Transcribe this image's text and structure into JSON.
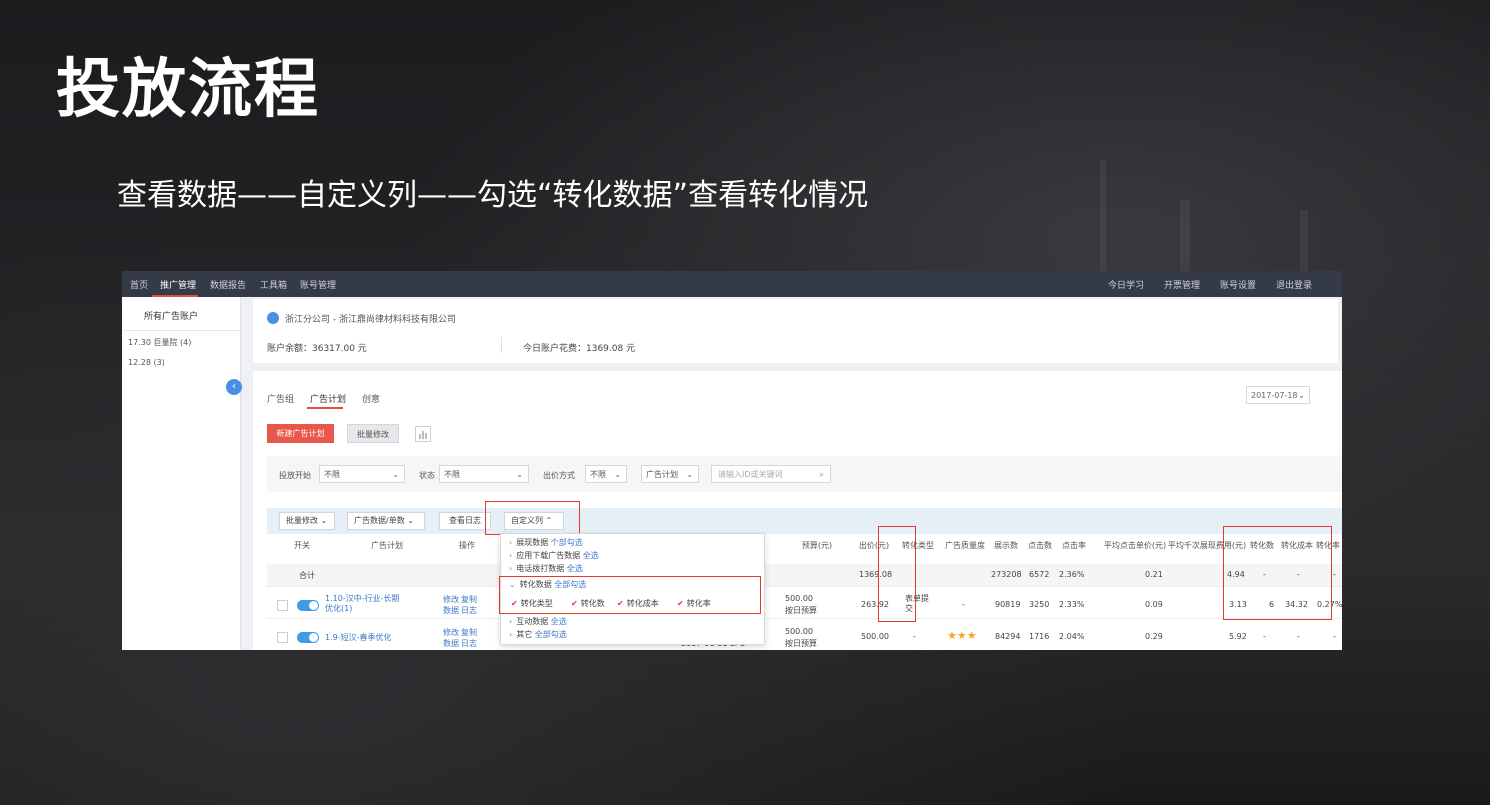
{
  "slide": {
    "title": "投放流程",
    "subtitle": "查看数据——自定义列——勾选“转化数据”查看转化情况"
  },
  "nav": {
    "items": [
      "首页",
      "推广管理",
      "数据报告",
      "工具箱",
      "账号管理"
    ],
    "right_items": [
      "今日学习",
      "开票管理",
      "账号设置",
      "退出登录"
    ]
  },
  "sidebar": {
    "title": "所有广告账户",
    "items": [
      "17.30 巨量院 (4)",
      "12.28 (3)"
    ]
  },
  "account": {
    "name": "浙江分公司 - 浙江鼎尚律材料科技有限公司",
    "balance": "账户余额：36317.00 元",
    "today_spend": "今日账户花费：1369.08 元"
  },
  "tabs": [
    "广告组",
    "广告计划",
    "创意"
  ],
  "date_select": "2017-07-18",
  "buttons": {
    "new_plan": "新建广告计划",
    "batch": "批量修改"
  },
  "filters": {
    "status_label": "投放开始",
    "status_value": "不限",
    "state_label": "状态",
    "state_value": "不限",
    "bid_label": "出价方式",
    "bid_value": "不限",
    "plan_select": "广告计划",
    "search_placeholder": "请输入ID或关键词"
  },
  "toolbar": {
    "batch_op": "批量修改",
    "data_switch": "广告数据/单数",
    "view_log": "查看日志",
    "custom_cols": "自定义列"
  },
  "table": {
    "headers": [
      "开关",
      "广告计划",
      "操作",
      "预算(元)",
      "出价(元)",
      "转化类型",
      "广告质量度",
      "展示数",
      "点击数",
      "点击率",
      "平均点击单价(元)",
      "平均千次展现费用(元)",
      "转化数",
      "转化成本",
      "转化率"
    ],
    "summary": {
      "label": "合计",
      "bid": "1369.08",
      "impressions": "273208",
      "clicks": "6572",
      "ctr": "2.36%",
      "cpc": "0.21",
      "cpm": "4.94",
      "conv": "-",
      "conv_cost": "-",
      "conv_rate": "-"
    },
    "rows": [
      {
        "name": "1.10-汉中-行业-长期优化(1)",
        "ops": [
          "修改",
          "复制",
          "数据",
          "日志"
        ],
        "budget": "500.00",
        "budget_type": "按日预算",
        "bid": "263.92",
        "conv_type": "表单提交",
        "quality": "-",
        "impressions": "90819",
        "clicks": "3250",
        "ctr": "2.33%",
        "cpc": "0.09",
        "cpm": "3.13",
        "conv": "6",
        "conv_cost": "34.32",
        "conv_rate": "0.27%"
      },
      {
        "name": "1.9-短汉-春季优化",
        "ops": [
          "修改",
          "复制",
          "数据",
          "日志"
        ],
        "date": "2017-01-31",
        "bid_mode": "CPC",
        "budget": "500.00",
        "budget_type": "按日预算",
        "bid": "500.00",
        "conv_type": "-",
        "quality": "★★★",
        "impressions": "84294",
        "clicks": "1716",
        "ctr": "2.04%",
        "cpc": "0.29",
        "cpm": "5.92",
        "conv": "-",
        "conv_cost": "-",
        "conv_rate": "-"
      }
    ]
  },
  "dropdown": {
    "items": [
      {
        "label": "展现数据",
        "tag": "个部勾选"
      },
      {
        "label": "应用下载广告数据",
        "tag": "全选"
      },
      {
        "label": "电话拨打数据",
        "tag": "全选"
      },
      {
        "label": "转化数据",
        "tag": "全部勾选"
      },
      {
        "label": "互动数据",
        "tag": "全选"
      },
      {
        "label": "其它",
        "tag": "全部勾选"
      }
    ],
    "checks": [
      "转化类型",
      "转化数",
      "转化成本",
      "转化率"
    ]
  },
  "colors": {
    "accent_red": "#e23b2e",
    "nav_bg": "#343a46",
    "toggle_blue": "#3f9be8"
  }
}
